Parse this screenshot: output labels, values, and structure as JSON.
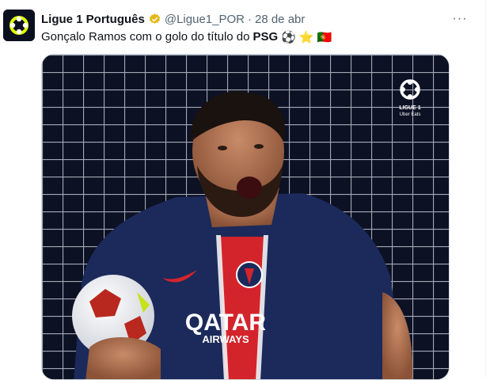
{
  "tweet": {
    "author_name": "Ligue 1 Português",
    "handle": "@Ligue1_POR",
    "separator": "·",
    "time": "28 de abr",
    "text_before": "Gonçalo Ramos com o golo do título do",
    "mention": "PSG",
    "emojis": [
      "⚽",
      "⭐",
      "🇵🇹"
    ],
    "more_label": "···"
  },
  "media": {
    "badge_line1": "LIGUE 1",
    "badge_line2": "Uber Eats",
    "jersey_sponsor": "QATAR",
    "jersey_sponsor2": "AIRWAYS"
  },
  "colors": {
    "verified_gold": "#e2b719",
    "text_secondary": "#536471",
    "psg_navy": "#1b2a5a",
    "psg_red": "#d3242c"
  }
}
